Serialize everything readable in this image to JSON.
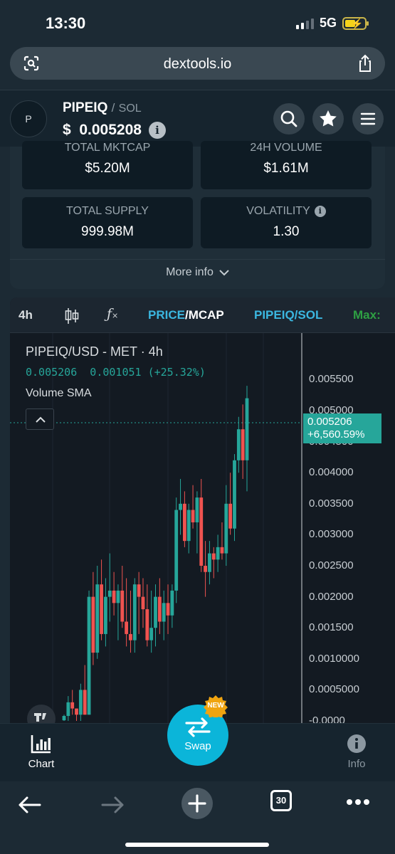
{
  "status_bar": {
    "time": "13:30",
    "network": "5G"
  },
  "url_bar": {
    "host": "dextools.io"
  },
  "header": {
    "avatar_letter": "P",
    "base_token": "PIPEIQ",
    "separator": "/",
    "quote_token": "SOL",
    "price": "$  0.005208"
  },
  "stats": {
    "total_mktcap": {
      "label": "TOTAL MKTCAP",
      "value": "$5.20M"
    },
    "volume_24h": {
      "label": "24H VOLUME",
      "value": "$1.61M"
    },
    "total_supply": {
      "label": "TOTAL SUPPLY",
      "value": "999.98M"
    },
    "volatility": {
      "label": "VOLATILITY",
      "value": "1.30"
    },
    "more_info": "More info"
  },
  "chart_toolbar": {
    "interval": "4h",
    "price_label": "PRICE",
    "slash": "/",
    "mcap_label": "MCAP",
    "pair_label": "PIPEIQ/SOL",
    "max_label": "Max:"
  },
  "chart_legend": {
    "title": "PIPEIQ/USD - MET · 4h",
    "ohlc": "0.005206  0.001051 (+25.32%)",
    "indicator": "Volume SMA"
  },
  "last_price_tag": {
    "price": "0.005206",
    "change": "+6,560.59%"
  },
  "colors": {
    "up": "#26a69a",
    "down": "#ef5350",
    "swap": "#0bb5d9",
    "accent_green": "#2ea043",
    "link_blue": "#3bb7e0"
  },
  "chart_data": {
    "type": "candlestick",
    "y_ticks": [
      "0.005500",
      "0.005000",
      "0.004500",
      "0.004000",
      "0.003500",
      "0.003000",
      "0.002500",
      "0.002000",
      "0.001500",
      "0.0010000",
      "0.0005000",
      "-0.0000"
    ],
    "ylim": [
      0,
      0.0057
    ],
    "candles": [
      [
        1e-05,
        0.0001,
        0.0,
        8e-05
      ],
      [
        8e-05,
        0.0004,
        0.0,
        0.0003
      ],
      [
        0.0003,
        0.0005,
        0.0001,
        0.0002
      ],
      [
        0.0002,
        0.0002,
        0.0,
        0.0001
      ],
      [
        0.0001,
        0.0006,
        0.0,
        0.0005
      ],
      [
        0.0005,
        0.0009,
        0.0001,
        0.0001
      ],
      [
        0.0001,
        0.0021,
        0.0001,
        0.002
      ],
      [
        0.002,
        0.0024,
        0.0009,
        0.0011
      ],
      [
        0.0011,
        0.0025,
        0.001,
        0.0022
      ],
      [
        0.0022,
        0.0026,
        0.0013,
        0.0014
      ],
      [
        0.0014,
        0.0023,
        0.0012,
        0.002
      ],
      [
        0.002,
        0.0027,
        0.0016,
        0.0021
      ],
      [
        0.0021,
        0.0024,
        0.0017,
        0.0019
      ],
      [
        0.0019,
        0.0022,
        0.0013,
        0.0021
      ],
      [
        0.0021,
        0.0025,
        0.0015,
        0.0016
      ],
      [
        0.0016,
        0.0023,
        0.0012,
        0.0014
      ],
      [
        0.0014,
        0.0021,
        0.0011,
        0.0013
      ],
      [
        0.0013,
        0.0023,
        0.0011,
        0.0022
      ],
      [
        0.0022,
        0.0024,
        0.0014,
        0.002
      ],
      [
        0.002,
        0.0023,
        0.0015,
        0.0018
      ],
      [
        0.0018,
        0.0022,
        0.0012,
        0.0013
      ],
      [
        0.0013,
        0.0021,
        0.0011,
        0.0015
      ],
      [
        0.0015,
        0.0022,
        0.0012,
        0.002
      ],
      [
        0.002,
        0.0023,
        0.0014,
        0.0016
      ],
      [
        0.0016,
        0.0021,
        0.0013,
        0.0019
      ],
      [
        0.0019,
        0.0022,
        0.0014,
        0.0017
      ],
      [
        0.0017,
        0.0022,
        0.0015,
        0.0021
      ],
      [
        0.0021,
        0.0036,
        0.0019,
        0.0034
      ],
      [
        0.0034,
        0.0039,
        0.003,
        0.0035
      ],
      [
        0.0035,
        0.0037,
        0.0028,
        0.0029
      ],
      [
        0.0029,
        0.0035,
        0.0027,
        0.0034
      ],
      [
        0.0034,
        0.0038,
        0.0031,
        0.0032
      ],
      [
        0.0032,
        0.0037,
        0.0027,
        0.0036
      ],
      [
        0.0036,
        0.0039,
        0.0024,
        0.0025
      ],
      [
        0.0025,
        0.0029,
        0.002,
        0.0024
      ],
      [
        0.0024,
        0.0029,
        0.0022,
        0.0027
      ],
      [
        0.0027,
        0.0028,
        0.0023,
        0.0026
      ],
      [
        0.0026,
        0.003,
        0.0024,
        0.0028
      ],
      [
        0.0028,
        0.0032,
        0.0026,
        0.0027
      ],
      [
        0.0027,
        0.0038,
        0.0025,
        0.0035
      ],
      [
        0.0035,
        0.004,
        0.003,
        0.0031
      ],
      [
        0.0031,
        0.0043,
        0.0029,
        0.0042
      ],
      [
        0.0042,
        0.0049,
        0.004,
        0.0047
      ],
      [
        0.0047,
        0.0051,
        0.0039,
        0.0042
      ],
      [
        0.0042,
        0.0054,
        0.0037,
        0.0052
      ]
    ]
  },
  "bottom_nav": {
    "chart": "Chart",
    "swap": "Swap",
    "new_badge": "NEW",
    "info": "Info"
  },
  "browser_bar": {
    "tab_count": "30"
  }
}
